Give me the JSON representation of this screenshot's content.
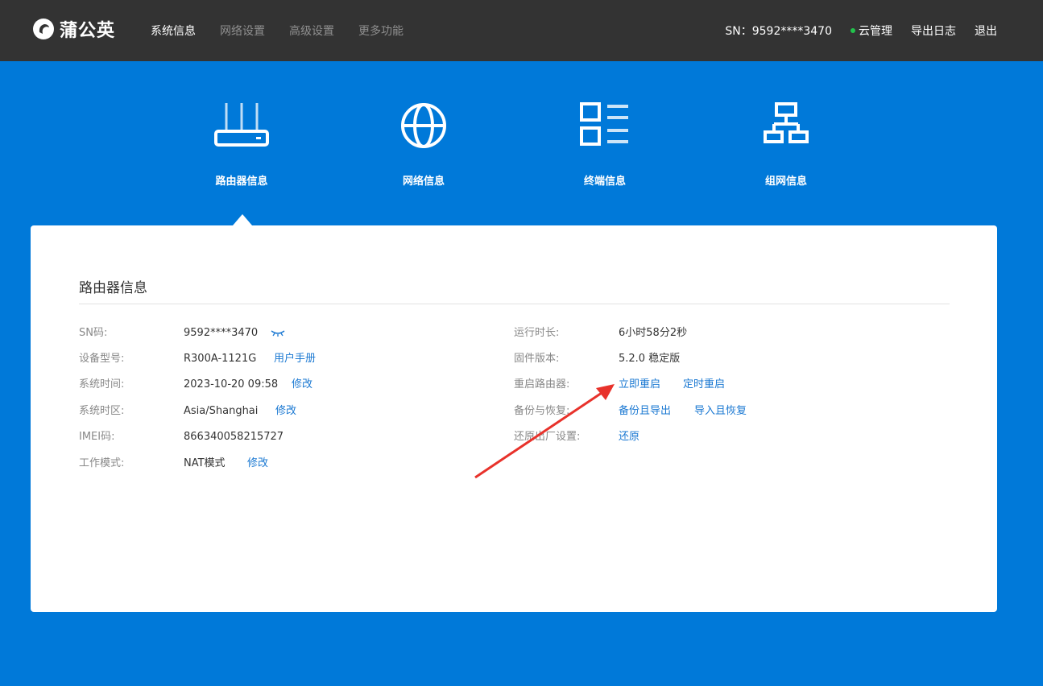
{
  "header": {
    "brand": "蒲公英",
    "nav": [
      {
        "label": "系统信息",
        "active": true
      },
      {
        "label": "网络设置",
        "active": false
      },
      {
        "label": "高级设置",
        "active": false
      },
      {
        "label": "更多功能",
        "active": false
      }
    ],
    "sn_text": "SN：9592****3470",
    "cloud_label": "云管理",
    "export_log": "导出日志",
    "logout": "退出"
  },
  "categories": [
    {
      "label": "路由器信息",
      "icon": "router-icon"
    },
    {
      "label": "网络信息",
      "icon": "globe-icon"
    },
    {
      "label": "终端信息",
      "icon": "list-icon"
    },
    {
      "label": "组网信息",
      "icon": "network-topology-icon"
    }
  ],
  "card": {
    "title": "路由器信息",
    "left": {
      "sn_label": "SN码:",
      "sn_value": "9592****3470",
      "model_label": "设备型号:",
      "model_value": "R300A-1121G",
      "model_link": "用户手册",
      "time_label": "系统时间:",
      "time_value": "2023-10-20 09:58",
      "time_link": "修改",
      "tz_label": "系统时区:",
      "tz_value": "Asia/Shanghai",
      "tz_link": "修改",
      "imei_label": "IMEI码:",
      "imei_value": "866340058215727",
      "mode_label": "工作模式:",
      "mode_value": "NAT模式",
      "mode_link": "修改"
    },
    "right": {
      "uptime_label": "运行时长:",
      "uptime_value": "6小时58分2秒",
      "fw_label": "固件版本:",
      "fw_value": "5.2.0 稳定版",
      "reboot_label": "重启路由器:",
      "reboot_now": "立即重启",
      "reboot_timed": "定时重启",
      "backup_label": "备份与恢复:",
      "backup_export": "备份且导出",
      "backup_import": "导入且恢复",
      "reset_label": "还原出厂设置:",
      "reset_link": "还原"
    }
  },
  "colors": {
    "topbar": "#333333",
    "background": "#0079d9",
    "link": "#1a78d2",
    "cloud_status": "#22c34c",
    "annotation_arrow": "#e8322b"
  }
}
